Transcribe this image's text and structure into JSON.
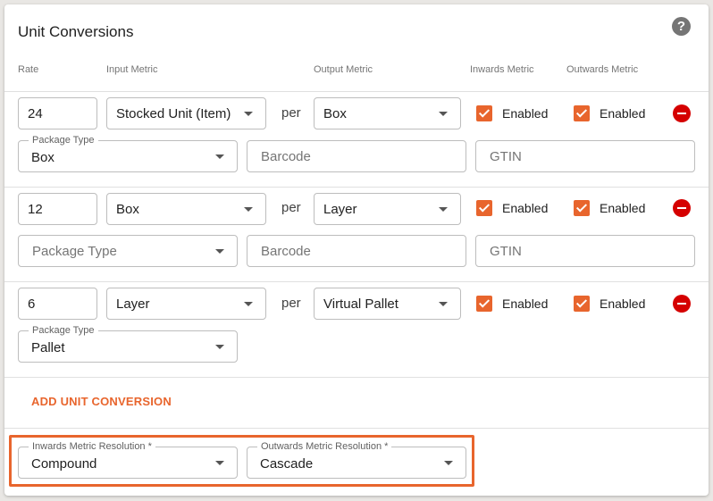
{
  "title": "Unit Conversions",
  "help_glyph": "?",
  "headers": {
    "rate": "Rate",
    "input_metric": "Input Metric",
    "output_metric": "Output Metric",
    "inwards_metric": "Inwards Metric",
    "outwards_metric": "Outwards Metric"
  },
  "conversions": [
    {
      "rate": "24",
      "input_metric": "Stocked Unit (Item)",
      "per": "per",
      "output_metric": "Box",
      "inwards": "Enabled",
      "outwards": "Enabled",
      "package_type_label": "Package Type",
      "package_type": "Box",
      "barcode_placeholder": "Barcode",
      "gtin_placeholder": "GTIN"
    },
    {
      "rate": "12",
      "input_metric": "Box",
      "per": "per",
      "output_metric": "Layer",
      "inwards": "Enabled",
      "outwards": "Enabled",
      "package_type_placeholder": "Package Type",
      "barcode_placeholder": "Barcode",
      "gtin_placeholder": "GTIN"
    },
    {
      "rate": "6",
      "input_metric": "Layer",
      "per": "per",
      "output_metric": "Virtual Pallet",
      "inwards": "Enabled",
      "outwards": "Enabled",
      "package_type_label": "Package Type",
      "package_type": "Pallet"
    }
  ],
  "add_button": "ADD UNIT CONVERSION",
  "resolution": {
    "inwards_label": "Inwards Metric Resolution *",
    "inwards_value": "Compound",
    "outwards_label": "Outwards Metric Resolution *",
    "outwards_value": "Cascade"
  },
  "colors": {
    "accent": "#e8652d",
    "remove": "#d50000"
  }
}
